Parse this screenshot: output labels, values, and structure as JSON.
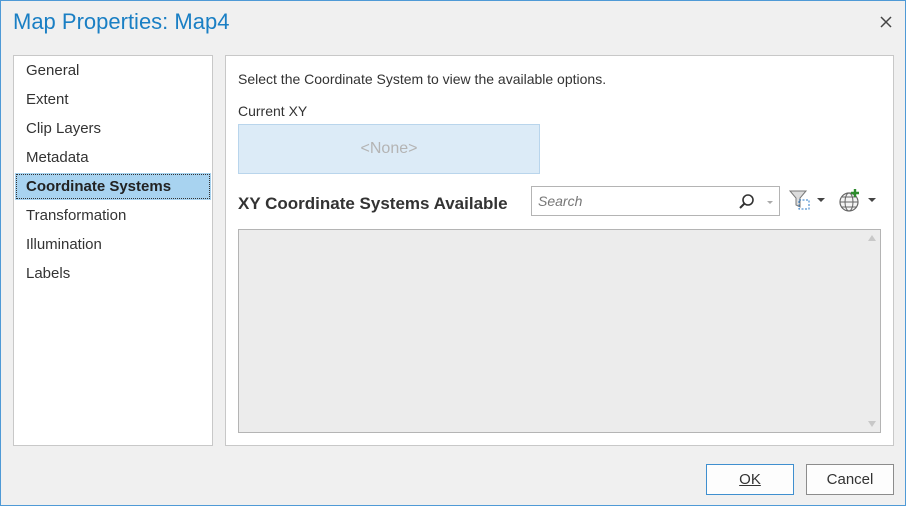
{
  "dialog": {
    "title": "Map Properties: Map4",
    "close_icon": "close-icon"
  },
  "nav": {
    "items": [
      {
        "label": "General"
      },
      {
        "label": "Extent"
      },
      {
        "label": "Clip Layers"
      },
      {
        "label": "Metadata"
      },
      {
        "label": "Coordinate Systems",
        "selected": true
      },
      {
        "label": "Transformation"
      },
      {
        "label": "Illumination"
      },
      {
        "label": "Labels"
      }
    ]
  },
  "content": {
    "instruction": "Select the Coordinate System to view the available options.",
    "current_label": "Current XY",
    "current_value": "<None>",
    "available_label": "XY Coordinate Systems Available",
    "search": {
      "placeholder": "Search",
      "value": ""
    },
    "icons": {
      "search": "search-icon",
      "filter": "filter-icon",
      "add_coordinate_system": "globe-add-icon"
    }
  },
  "footer": {
    "ok_label": "OK",
    "cancel_label": "Cancel"
  },
  "colors": {
    "accent": "#1a7fc4",
    "selected_item": "#a8d3f0",
    "current_box": "#dcebf7"
  }
}
